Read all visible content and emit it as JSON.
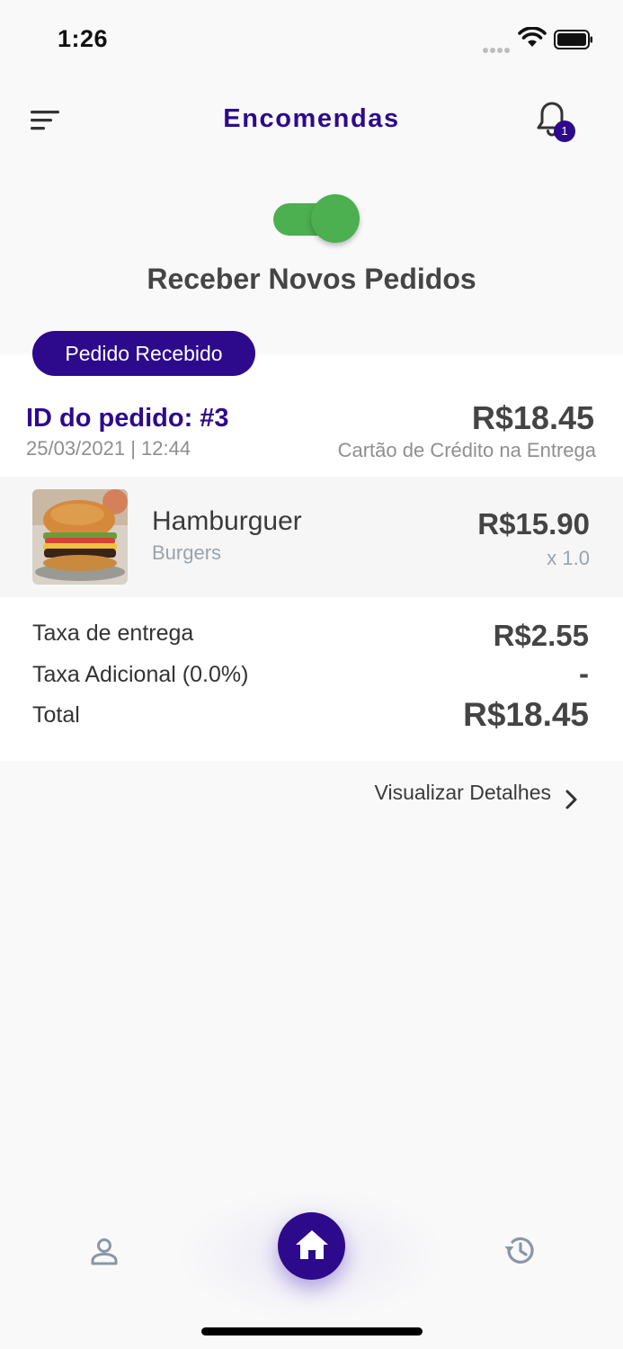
{
  "status_bar": {
    "time": "1:26"
  },
  "header": {
    "title": "Encomendas",
    "notification_count": "1"
  },
  "toggle": {
    "label": "Receber Novos Pedidos",
    "on": true
  },
  "order": {
    "status": "Pedido Recebido",
    "id_label": "ID do pedido: #3",
    "datetime": "25/03/2021 | 12:44",
    "total": "R$18.45",
    "payment_method": "Cartão de Crédito na Entrega",
    "items": [
      {
        "name": "Hamburguer",
        "category": "Burgers",
        "price": "R$15.90",
        "quantity": "x 1.0"
      }
    ],
    "fees": [
      {
        "label": "Taxa de entrega",
        "value": "R$2.55"
      },
      {
        "label": "Taxa Adicional (0.0%)",
        "value": "-"
      },
      {
        "label": "Total",
        "value": "R$18.45"
      }
    ],
    "details_link": "Visualizar Detalhes"
  },
  "colors": {
    "primary": "#2d0a8c",
    "toggle_on": "#4caf50",
    "muted": "#8f8f8f"
  },
  "icons": {
    "menu": "menu-icon",
    "notification": "bell-icon",
    "profile": "person-icon",
    "home": "home-icon",
    "history": "history-icon",
    "details": "chevron-right-icon"
  }
}
